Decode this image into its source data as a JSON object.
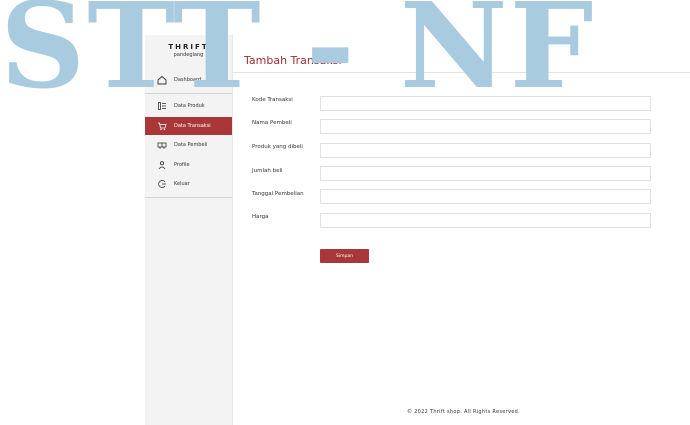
{
  "watermark": "STT - NF",
  "brand": {
    "title": "THRIFT",
    "subtitle": "pandeglang"
  },
  "sidebar": {
    "items": [
      {
        "label": "Dashboard",
        "icon": "home-icon"
      },
      {
        "label": "Data Produk",
        "icon": "list-icon"
      },
      {
        "label": "Data Transaksi",
        "icon": "cart-icon",
        "active": true
      },
      {
        "label": "Data Pembeli",
        "icon": "users-icon"
      },
      {
        "label": "Profile",
        "icon": "user-icon"
      },
      {
        "label": "Keluar",
        "icon": "logout-icon"
      }
    ]
  },
  "main": {
    "title": "Tambah Transaksi",
    "fields": [
      {
        "label": "Kode Transaksi",
        "value": ""
      },
      {
        "label": "Nama Pembeli",
        "value": ""
      },
      {
        "label": "Produk yang dibeli",
        "value": ""
      },
      {
        "label": "Jumlah  beli",
        "value": ""
      },
      {
        "label": "Tanggal Pembelian",
        "value": ""
      },
      {
        "label": "Harga",
        "value": ""
      }
    ],
    "submit_label": "Simpan"
  },
  "footer": {
    "text": "© 2022 Thrift shop. All Rights Reserved."
  },
  "colors": {
    "accent": "#a93737",
    "title": "#9c2e32",
    "watermark": "#a9cbe0"
  }
}
